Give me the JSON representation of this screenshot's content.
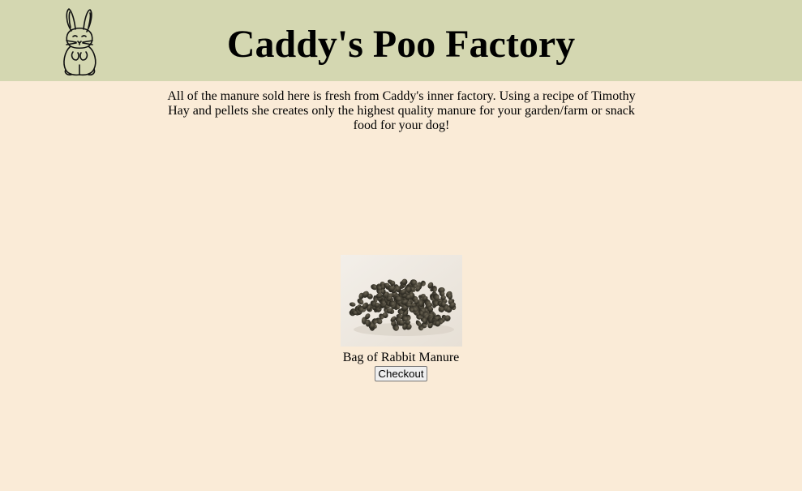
{
  "header": {
    "title": "Caddy's Poo Factory",
    "logo_icon": "rabbit-icon",
    "background_color": "#d4d7b1"
  },
  "intro": {
    "text": "All of the manure sold here is fresh from Caddy's inner factory. Using a recipe of Timothy Hay and pellets she creates only the highest quality manure for your garden/farm or snack food for your dog!"
  },
  "product": {
    "image_icon": "rabbit-pellets-image",
    "name": "Bag of Rabbit Manure",
    "checkout_label": "Checkout"
  },
  "page": {
    "background_color": "#faebd7"
  }
}
